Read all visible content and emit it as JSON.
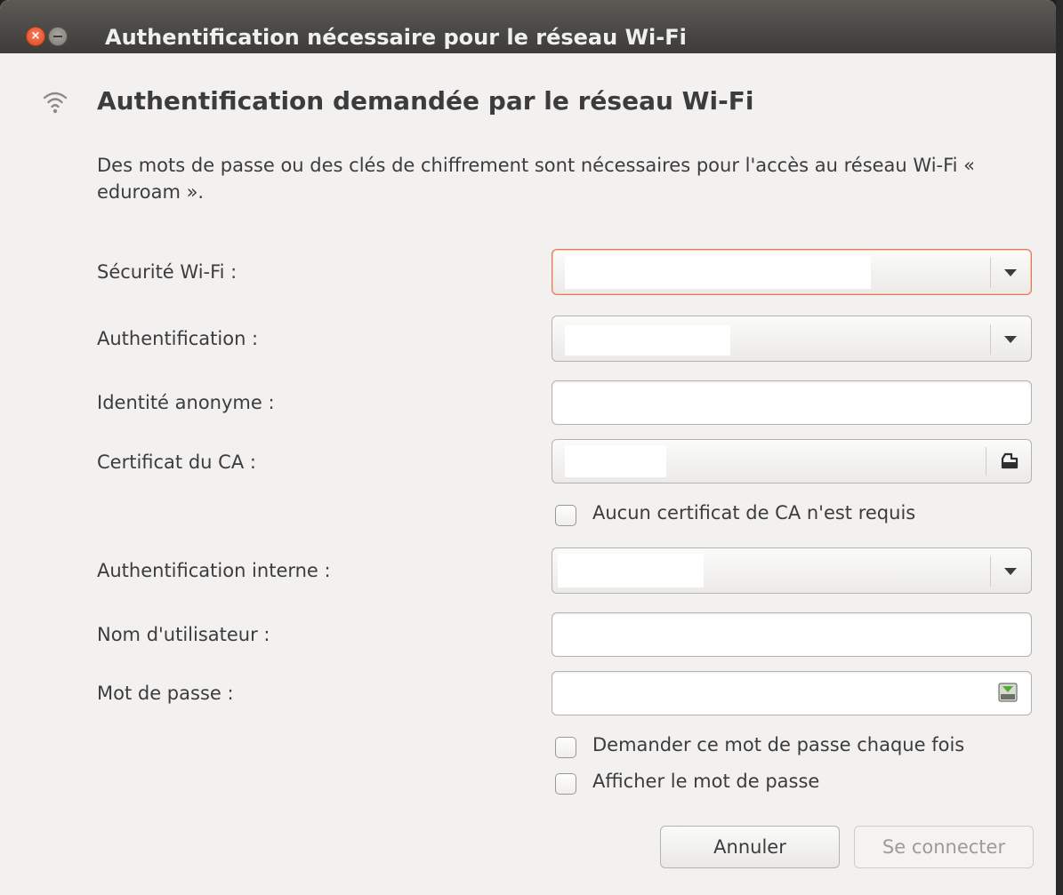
{
  "window": {
    "title": "Authentification nécessaire pour le réseau Wi-Fi",
    "close_glyph": "×"
  },
  "dialog": {
    "heading": "Authentification demandée par le réseau Wi-Fi",
    "description": "Des mots de passe ou des clés de chiffrement sont nécessaires pour l'accès au réseau Wi-Fi « eduroam ».",
    "icon": "wifi-icon"
  },
  "form": {
    "wifi_security_label": "Sécurité Wi-Fi :",
    "authentication_label": "Authentification :",
    "anonymous_identity_label": "Identité anonyme :",
    "ca_certificate_label": "Certificat du CA :",
    "no_ca_required_label": "Aucun certificat de CA n'est requis",
    "inner_authentication_label": "Authentification interne :",
    "username_label": "Nom d'utilisateur :",
    "password_label": "Mot de passe :",
    "ask_password_label": "Demander ce mot de passe chaque fois",
    "show_password_label": "Afficher le mot de passe"
  },
  "buttons": {
    "cancel": "Annuler",
    "connect": "Se connecter"
  },
  "colors": {
    "focus_border": "#e07a58",
    "titlebar": "#3d3c39",
    "close_button": "#e0461c",
    "dialog_bg": "#f2f1f0"
  }
}
